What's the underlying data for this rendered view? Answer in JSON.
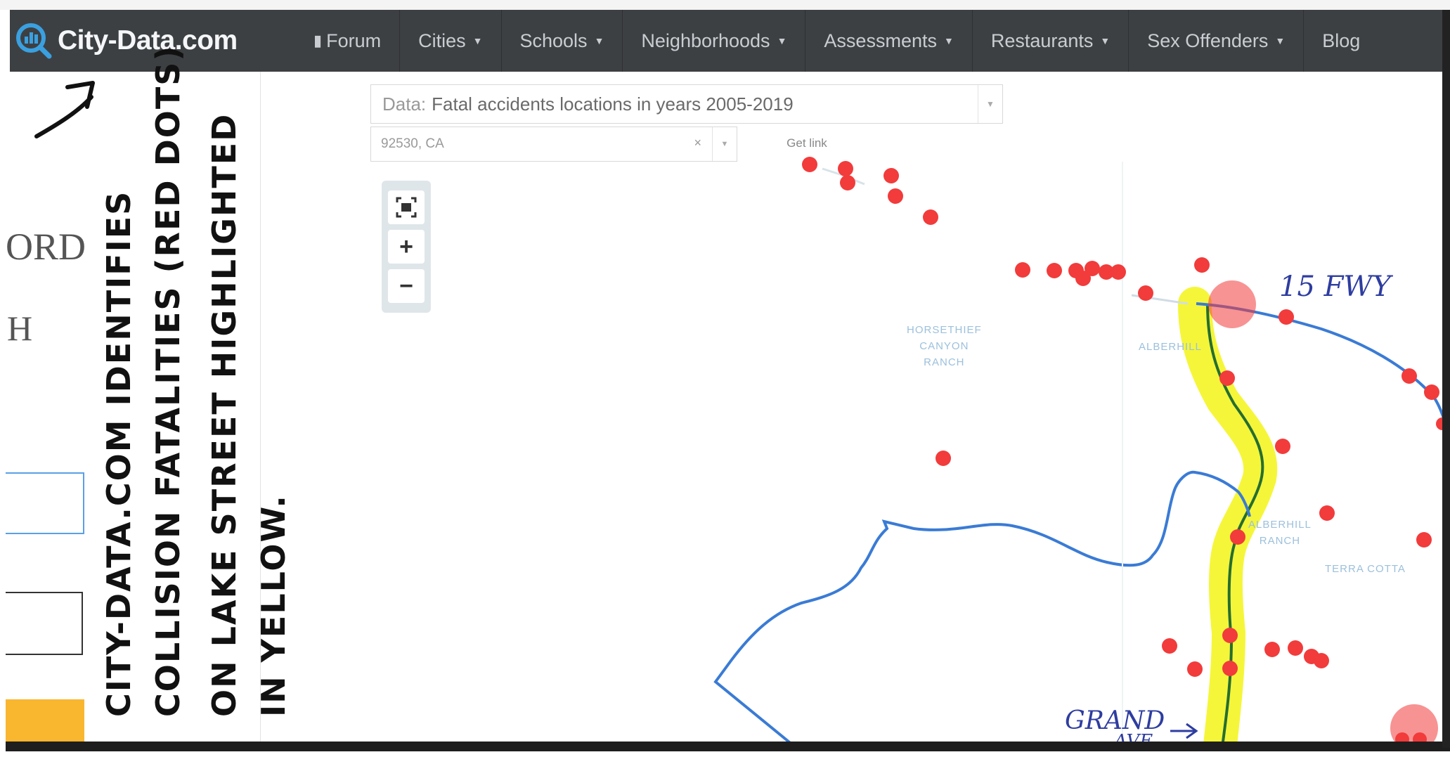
{
  "brand": {
    "name": "City-Data.com"
  },
  "nav": {
    "items": [
      {
        "label": "Forum"
      },
      {
        "label": "Cities"
      },
      {
        "label": "Schools"
      },
      {
        "label": "Neighborhoods"
      },
      {
        "label": "Assessments"
      },
      {
        "label": "Restaurants"
      },
      {
        "label": "Sex Offenders"
      },
      {
        "label": "Blog"
      }
    ]
  },
  "data_select": {
    "prefix": "Data:",
    "value": "Fatal accidents locations in years 2005-2019"
  },
  "location": {
    "value": "92530, CA",
    "clear": "×"
  },
  "get_link": {
    "label": "Get link"
  },
  "map": {
    "labels": [
      {
        "text": "HORSETHIEF\nCANYON\nRANCH"
      },
      {
        "text": "ALBERHILL"
      },
      {
        "text": "ALBERHILL\nRANCH"
      },
      {
        "text": "TERRA COTTA"
      }
    ],
    "controls": {
      "fit": "fit-extent-icon",
      "zoom_in": "+",
      "zoom_out": "−"
    }
  },
  "left_page": {
    "fragment1": "ORD",
    "fragment2": "H"
  },
  "annotations": {
    "lines": [
      "CITY-DATA.COM IDENTIFIES",
      "COLLISION FATALITIES (RED DOTS)",
      "ON LAKE STREET HIGHLIGHTED",
      "IN YELLOW."
    ],
    "fwy_label": "15 FWY",
    "grand_label_1": "GRAND",
    "grand_label_2": "AVE"
  },
  "colors": {
    "navbar": "#3d4043",
    "dot": "#f23b3b",
    "highlight": "#f3f516",
    "route": "#3a7bd5"
  }
}
